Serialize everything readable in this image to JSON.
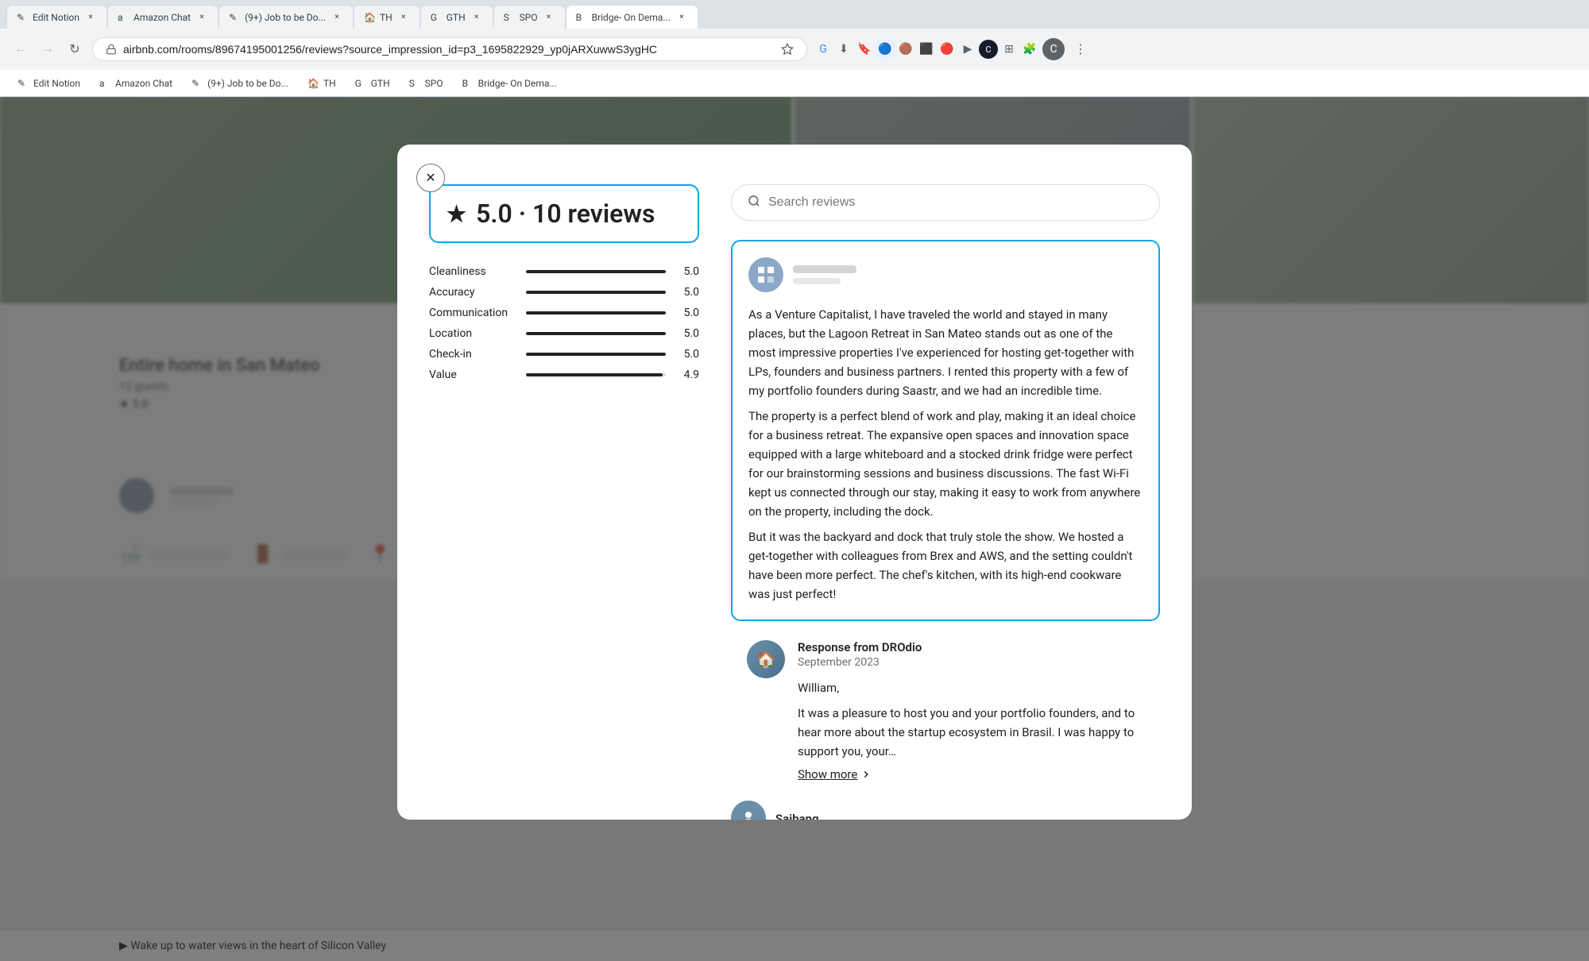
{
  "browser": {
    "url": "airbnb.com/rooms/89674195001256/reviews?source_impression_id=p3_1695822929_yp0jARXuwwS3ygHC",
    "url_full": "airbnb.com/rooms/89674195001256/reviews?source_impression_id=p3_1695822929_yp0jARXuwwS3ygHC",
    "tabs": [
      {
        "label": "Edit Notion",
        "active": false,
        "favicon": "✎"
      },
      {
        "label": "Amazon Chat",
        "active": false,
        "favicon": "a"
      },
      {
        "label": "(9+) Job to be Do...",
        "active": false,
        "favicon": "✎"
      },
      {
        "label": "TH",
        "active": false,
        "favicon": "🏠"
      },
      {
        "label": "GTH",
        "active": false,
        "favicon": "G"
      },
      {
        "label": "SPO",
        "active": false,
        "favicon": "S"
      },
      {
        "label": "Bridge- On Dema...",
        "active": true,
        "favicon": "B"
      }
    ],
    "bookmarks": [
      {
        "label": "Edit Notion",
        "favicon": "✎"
      },
      {
        "label": "Amazon Chat",
        "favicon": "a"
      },
      {
        "label": "(9+) Job to be Do...",
        "favicon": "✎"
      },
      {
        "label": "TH",
        "favicon": "🏠"
      },
      {
        "label": "GTH",
        "favicon": "G"
      },
      {
        "label": "SPO",
        "favicon": "S"
      },
      {
        "label": "Bridge- On Dema...",
        "favicon": "B"
      }
    ]
  },
  "modal": {
    "close_label": "×",
    "overall_rating": "5.0 · 10 reviews",
    "search_placeholder": "Search reviews",
    "rating_rows": [
      {
        "label": "Cleanliness",
        "value": "5.0",
        "percent": 100
      },
      {
        "label": "Accuracy",
        "value": "5.0",
        "percent": 100
      },
      {
        "label": "Communication",
        "value": "5.0",
        "percent": 100
      },
      {
        "label": "Location",
        "value": "5.0",
        "percent": 100
      },
      {
        "label": "Check-in",
        "value": "5.0",
        "percent": 100
      },
      {
        "label": "Value",
        "value": "4.9",
        "percent": 98
      }
    ],
    "review": {
      "text_p1": "As a Venture Capitalist, I have traveled the world and stayed in many places, but the Lagoon Retreat in San Mateo stands out as one of the most impressive properties I've experienced for hosting get-together with LPs, founders and business partners. I rented this property with a few of my portfolio founders during Saastr, and we had an incredible time.",
      "text_p2": "The property is a perfect blend of work and play, making it an ideal choice for a business retreat. The expansive open spaces and innovation space equipped with a large whiteboard and a stocked drink fridge were perfect for our brainstorming sessions and business discussions. The fast Wi-Fi kept us connected through our stay, making it easy to work from anywhere on the property, including the dock.",
      "text_p3": "But it was the backyard and dock that truly stole the show. We hosted a get-together with colleagues from Brex and AWS, and the setting couldn't have been more perfect. The chef's kitchen, with its high-end cookware was just perfect!"
    },
    "host_response": {
      "title": "Response from DROdio",
      "date": "September 2023",
      "greeting": "William,",
      "text": "It was a pleasure to host you and your portfolio founders, and to hear more about the startup ecosystem in Brasil. I was happy to support you, your…",
      "show_more": "Show more"
    },
    "next_reviewer_name": "Saibang,"
  }
}
